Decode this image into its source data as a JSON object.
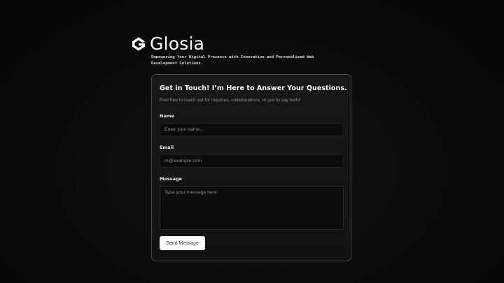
{
  "brand": {
    "logo_icon": "g-logo-icon",
    "name": "Glosia",
    "tagline": "Empowering Your Digital Presence with Innovative and Personalized Web Development Solutions."
  },
  "contact_form": {
    "title": "Get in Touch! I’m Here to Answer Your Questions.",
    "subtitle": "Feel free to reach out for inquiries, collaborations, or just to say hello!",
    "fields": {
      "name": {
        "label": "Name",
        "placeholder": "Enter your name...",
        "value": ""
      },
      "email": {
        "label": "Email",
        "placeholder": "m@example.com",
        "value": ""
      },
      "message": {
        "label": "Message",
        "placeholder": "Type your message here.",
        "value": ""
      }
    },
    "submit_label": "Send Message"
  },
  "colors": {
    "background": "#0a0a0a",
    "card_background": "#141414",
    "card_border": "#4a4a4a",
    "button_background": "#ffffff",
    "text_primary": "#ffffff",
    "text_muted": "#8f8f8f"
  }
}
